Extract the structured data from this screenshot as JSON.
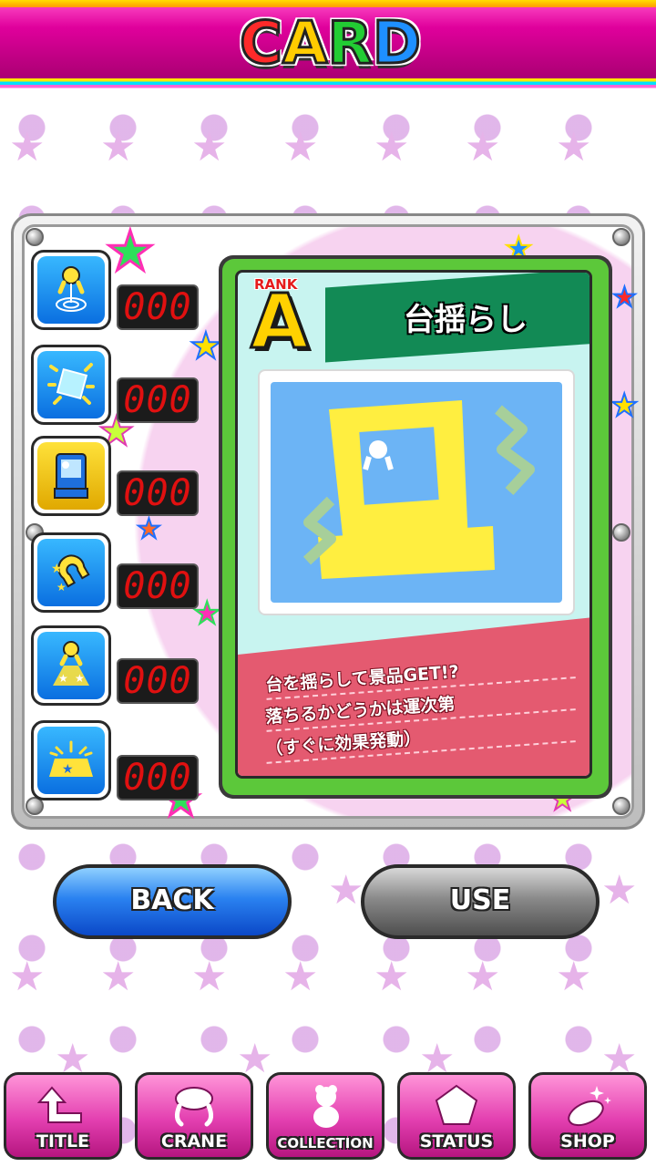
{
  "header": {
    "title_letters": [
      "C",
      "A",
      "R",
      "D"
    ],
    "title_colors": [
      "#ff2a2a",
      "#ffcc00",
      "#22cc33",
      "#1e90ff"
    ]
  },
  "slots": [
    {
      "icon": "claw-target-icon",
      "count": "000"
    },
    {
      "icon": "sparkle-box-icon",
      "count": "000"
    },
    {
      "icon": "shaking-machine-icon",
      "count": "000",
      "active": true
    },
    {
      "icon": "magnet-icon",
      "count": "000"
    },
    {
      "icon": "claw-spotlight-icon",
      "count": "000"
    },
    {
      "icon": "prize-burst-icon",
      "count": "000"
    }
  ],
  "card": {
    "rank_label": "RANK",
    "rank_value": "A",
    "name": "台揺らし",
    "description_lines": [
      "台を揺らして景品GET!?",
      "落ちるかどうかは運次第",
      "（すぐに効果発動）"
    ]
  },
  "buttons": {
    "back": "BACK",
    "use": "USE"
  },
  "nav": [
    {
      "label": "TITLE",
      "icon": "return-arrow-icon"
    },
    {
      "label": "CRANE",
      "icon": "crane-claw-icon"
    },
    {
      "label": "COLLECTION",
      "icon": "teddy-bear-icon"
    },
    {
      "label": "STATUS",
      "icon": "pentagon-icon"
    },
    {
      "label": "SHOP",
      "icon": "coin-sparkle-icon"
    }
  ],
  "colors": {
    "accent_pink": "#e33fb0",
    "card_green": "#5cc83a",
    "banner_green": "#128a55",
    "desc_red": "#e45a70"
  }
}
